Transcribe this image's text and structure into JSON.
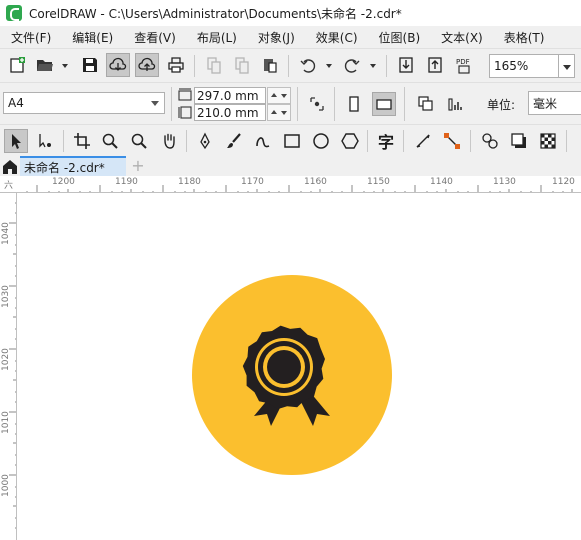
{
  "window": {
    "title": "CorelDRAW - C:\\Users\\Administrator\\Documents\\未命名 -2.cdr*"
  },
  "menu": {
    "items": [
      {
        "label": "文件(F)"
      },
      {
        "label": "编辑(E)"
      },
      {
        "label": "查看(V)"
      },
      {
        "label": "布局(L)"
      },
      {
        "label": "对象(J)"
      },
      {
        "label": "效果(C)"
      },
      {
        "label": "位图(B)"
      },
      {
        "label": "文本(X)"
      },
      {
        "label": "表格(T)"
      }
    ]
  },
  "standard_toolbar": {
    "pdf_label": "PDF",
    "zoom_value": "165%"
  },
  "property_bar": {
    "page_size": "A4",
    "width": "297.0 mm",
    "height": "210.0 mm",
    "unit_label": "单位:",
    "unit_value": "毫米"
  },
  "toolbox": {
    "text_tool_glyph": "字"
  },
  "tabs": {
    "document_tab": "未命名 -2.cdr*",
    "add_tab": "+"
  },
  "rulers": {
    "horizontal_labels": [
      "1200",
      "1190",
      "1180",
      "1170",
      "1160",
      "1150",
      "1140",
      "1130",
      "1120"
    ],
    "vertical_labels": [
      "1040",
      "1030",
      "1020",
      "1010",
      "1000"
    ],
    "corner_glyph": "六"
  },
  "canvas": {
    "badge_circle_color": "#FBBF2E",
    "icon_color": "#231F20",
    "icon": "award-ribbon-icon"
  }
}
